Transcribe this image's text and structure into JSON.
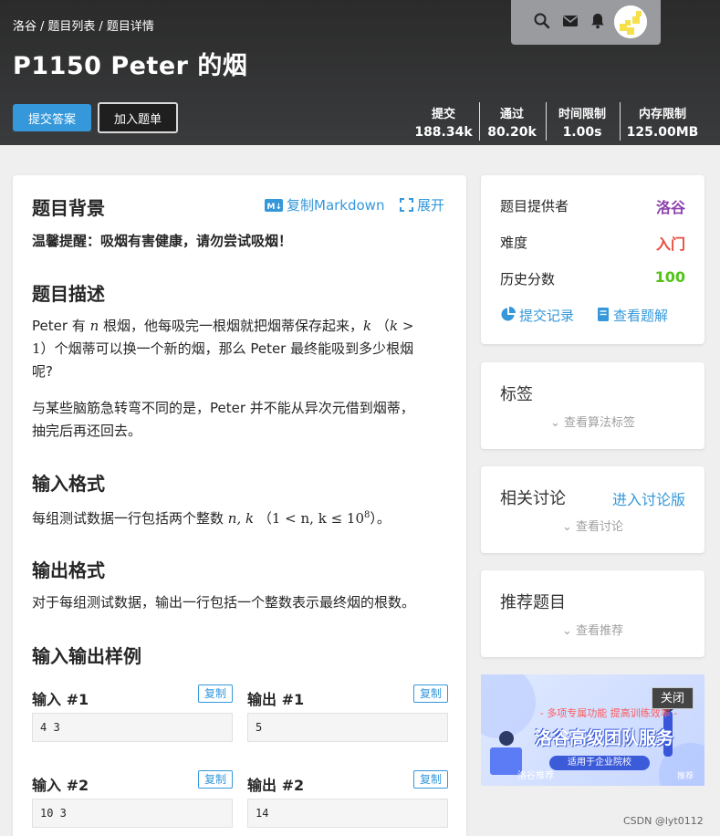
{
  "breadcrumb": [
    "洛谷",
    "题目列表",
    "题目详情"
  ],
  "breadcrumb_sep": "/",
  "title": "P1150 Peter 的烟",
  "actions": {
    "submit": "提交答案",
    "add_list": "加入题单"
  },
  "stats": [
    {
      "label": "提交",
      "value": "188.34k"
    },
    {
      "label": "通过",
      "value": "80.20k"
    },
    {
      "label": "时间限制",
      "value": "1.00s"
    },
    {
      "label": "内存限制",
      "value": "125.00MB"
    }
  ],
  "toolbar": {
    "copy_markdown": "复制Markdown",
    "expand": "展开"
  },
  "sections": {
    "background_title": "题目背景",
    "background_text": "温馨提醒：吸烟有害健康，请勿尝试吸烟！",
    "description_title": "题目描述",
    "desc_p1_a": "Peter 有",
    "desc_p1_n": "n",
    "desc_p1_b": "根烟，他每吸完一根烟就把烟蒂保存起来，",
    "desc_p1_k": "k",
    "desc_p1_paren": "（",
    "desc_p1_k2": "k",
    "desc_p1_gt": ">",
    "desc_p1_one": "1",
    "desc_p1_paren_close": "）",
    "desc_p1_c": "个烟蒂可以换一个新的烟，那么 Peter 最终能吸到多少根烟",
    "desc_p1_d": "呢?",
    "desc_p2_a": "与某些脑筋急转弯不同的是，Peter 并不能从异次元借到烟蒂，",
    "desc_p2_b": "抽完后再还回去。",
    "input_title": "输入格式",
    "input_text_a": "每组测试数据一行包括两个整数",
    "input_math_vars": "n, k",
    "input_math_cond": "（1 < n, k ≤ 10",
    "input_math_exp": "8",
    "input_math_end": "）。",
    "output_title": "输出格式",
    "output_text": "对于每组测试数据，输出一行包括一个整数表示最终烟的根数。",
    "samples_title": "输入输出样例"
  },
  "samples": [
    {
      "in_label": "输入 #1",
      "out_label": "输出 #1",
      "in": "4 3",
      "out": "5",
      "copy": "复制"
    },
    {
      "in_label": "输入 #2",
      "out_label": "输出 #2",
      "in": "10 3",
      "out": "14",
      "copy": "复制"
    }
  ],
  "info": {
    "provider_label": "题目提供者",
    "provider_value": "洛谷",
    "difficulty_label": "难度",
    "difficulty_value": "入门",
    "score_label": "历史分数",
    "score_value": "100",
    "submissions_link": "提交记录",
    "solutions_link": "查看题解"
  },
  "tags": {
    "title": "标签",
    "sub": "查看算法标签"
  },
  "discuss": {
    "title": "相关讨论",
    "link": "进入讨论版",
    "sub": "查看讨论"
  },
  "recommend": {
    "title": "推荐题目",
    "sub": "查看推荐"
  },
  "ad": {
    "close": "关闭",
    "line1": "- 多项专属功能  提高训练效率 -",
    "line2": "洛谷高级团队服务",
    "line3": "适用于企业院校",
    "corner": "洛谷推荐",
    "corner2": "推荐"
  },
  "watermark": "CSDN @lyt0112",
  "colors": {
    "accent": "#3498db",
    "provider": "#8e44ad",
    "difficulty": "#e74c3c",
    "score": "#52c41a"
  }
}
